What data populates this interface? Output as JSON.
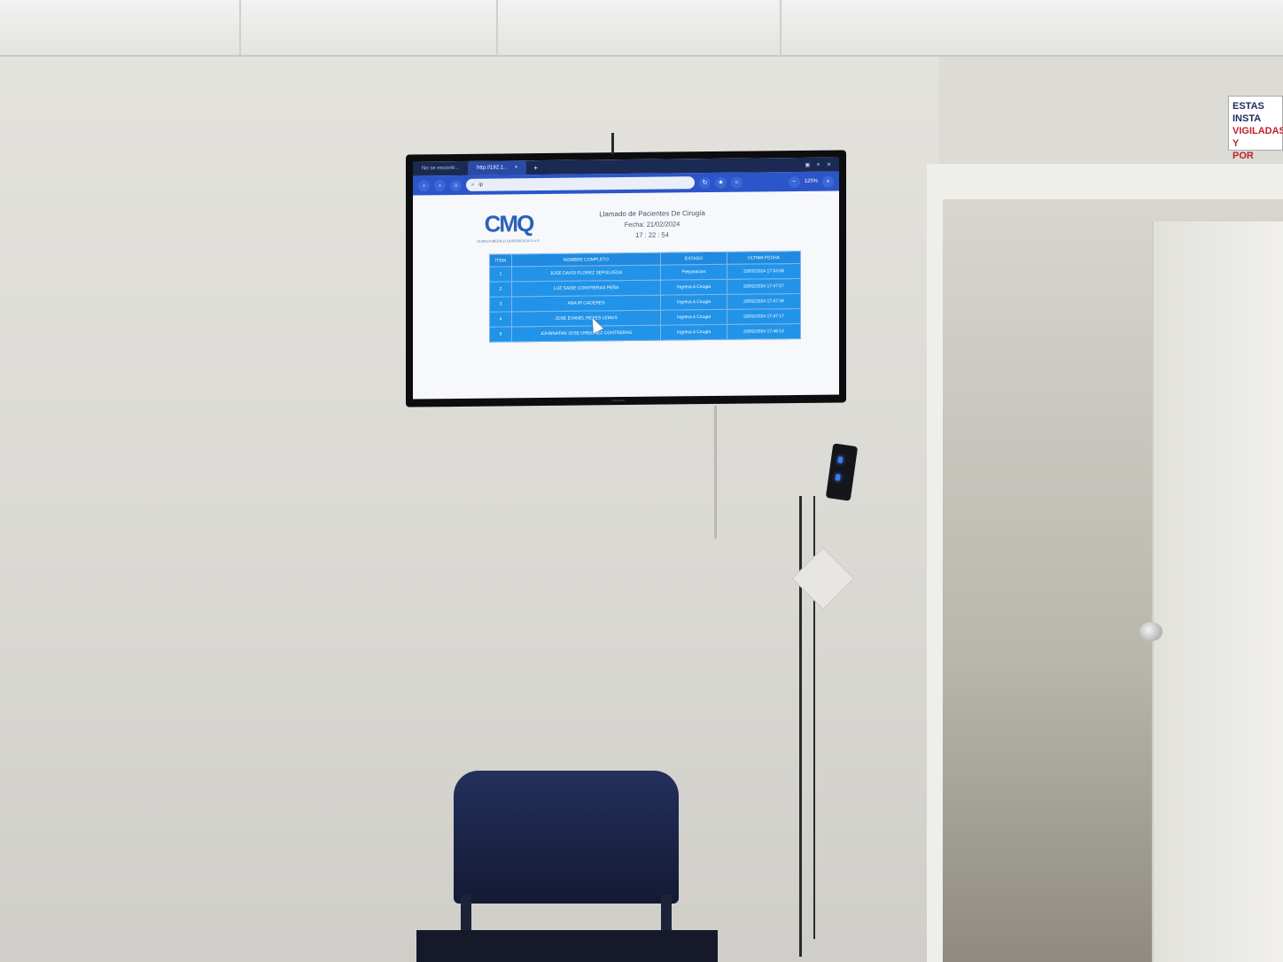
{
  "browser": {
    "tabs": [
      {
        "label": "No se encontr..."
      },
      {
        "label": "http://192.1..."
      }
    ],
    "new_tab_icon": "plus-icon",
    "address_text": "ip",
    "zoom_level": "125%"
  },
  "page": {
    "logo_text": "CMQ",
    "logo_subtext": "CLINICA MEDICO QUIRURGICA S.A.S.",
    "title": "Llamado de Pacientes De Cirugía",
    "date_label": "Fecha: 21/02/2024",
    "clock": "17 : 22 : 54",
    "table": {
      "headers": [
        "ITEM",
        "NOMBRE COMPLETO",
        "ESTADO",
        "ULTIMA FECHA"
      ],
      "rows": [
        [
          "1",
          "JOSE DAVID FLOREZ SEPULVEDA",
          "Preparacion",
          "20/02/2024 17:53:06"
        ],
        [
          "2",
          "LUZ SAIDE CONTRERAS PEÑA",
          "Ingresa A Cirugia",
          "20/02/2024 17:47:57"
        ],
        [
          "3",
          "ANA IR CACERES",
          "Ingresa A Cirugia",
          "20/02/2024 17:47:39"
        ],
        [
          "4",
          "JOSE EVANEL REYES LEMUS",
          "Ingresa A Cirugia",
          "20/02/2024 17:47:17"
        ],
        [
          "5",
          "JOHNNATAN JOSE ORDOÑEZ CONTRERAS",
          "Ingresa A Cirugia",
          "20/02/2024 17:46:12"
        ]
      ]
    }
  },
  "tv_brand": "SAMSUNG",
  "wall_sign": {
    "line1": "ESTAS INSTA",
    "line2": "VIGILADAS Y",
    "line3": "POR"
  }
}
